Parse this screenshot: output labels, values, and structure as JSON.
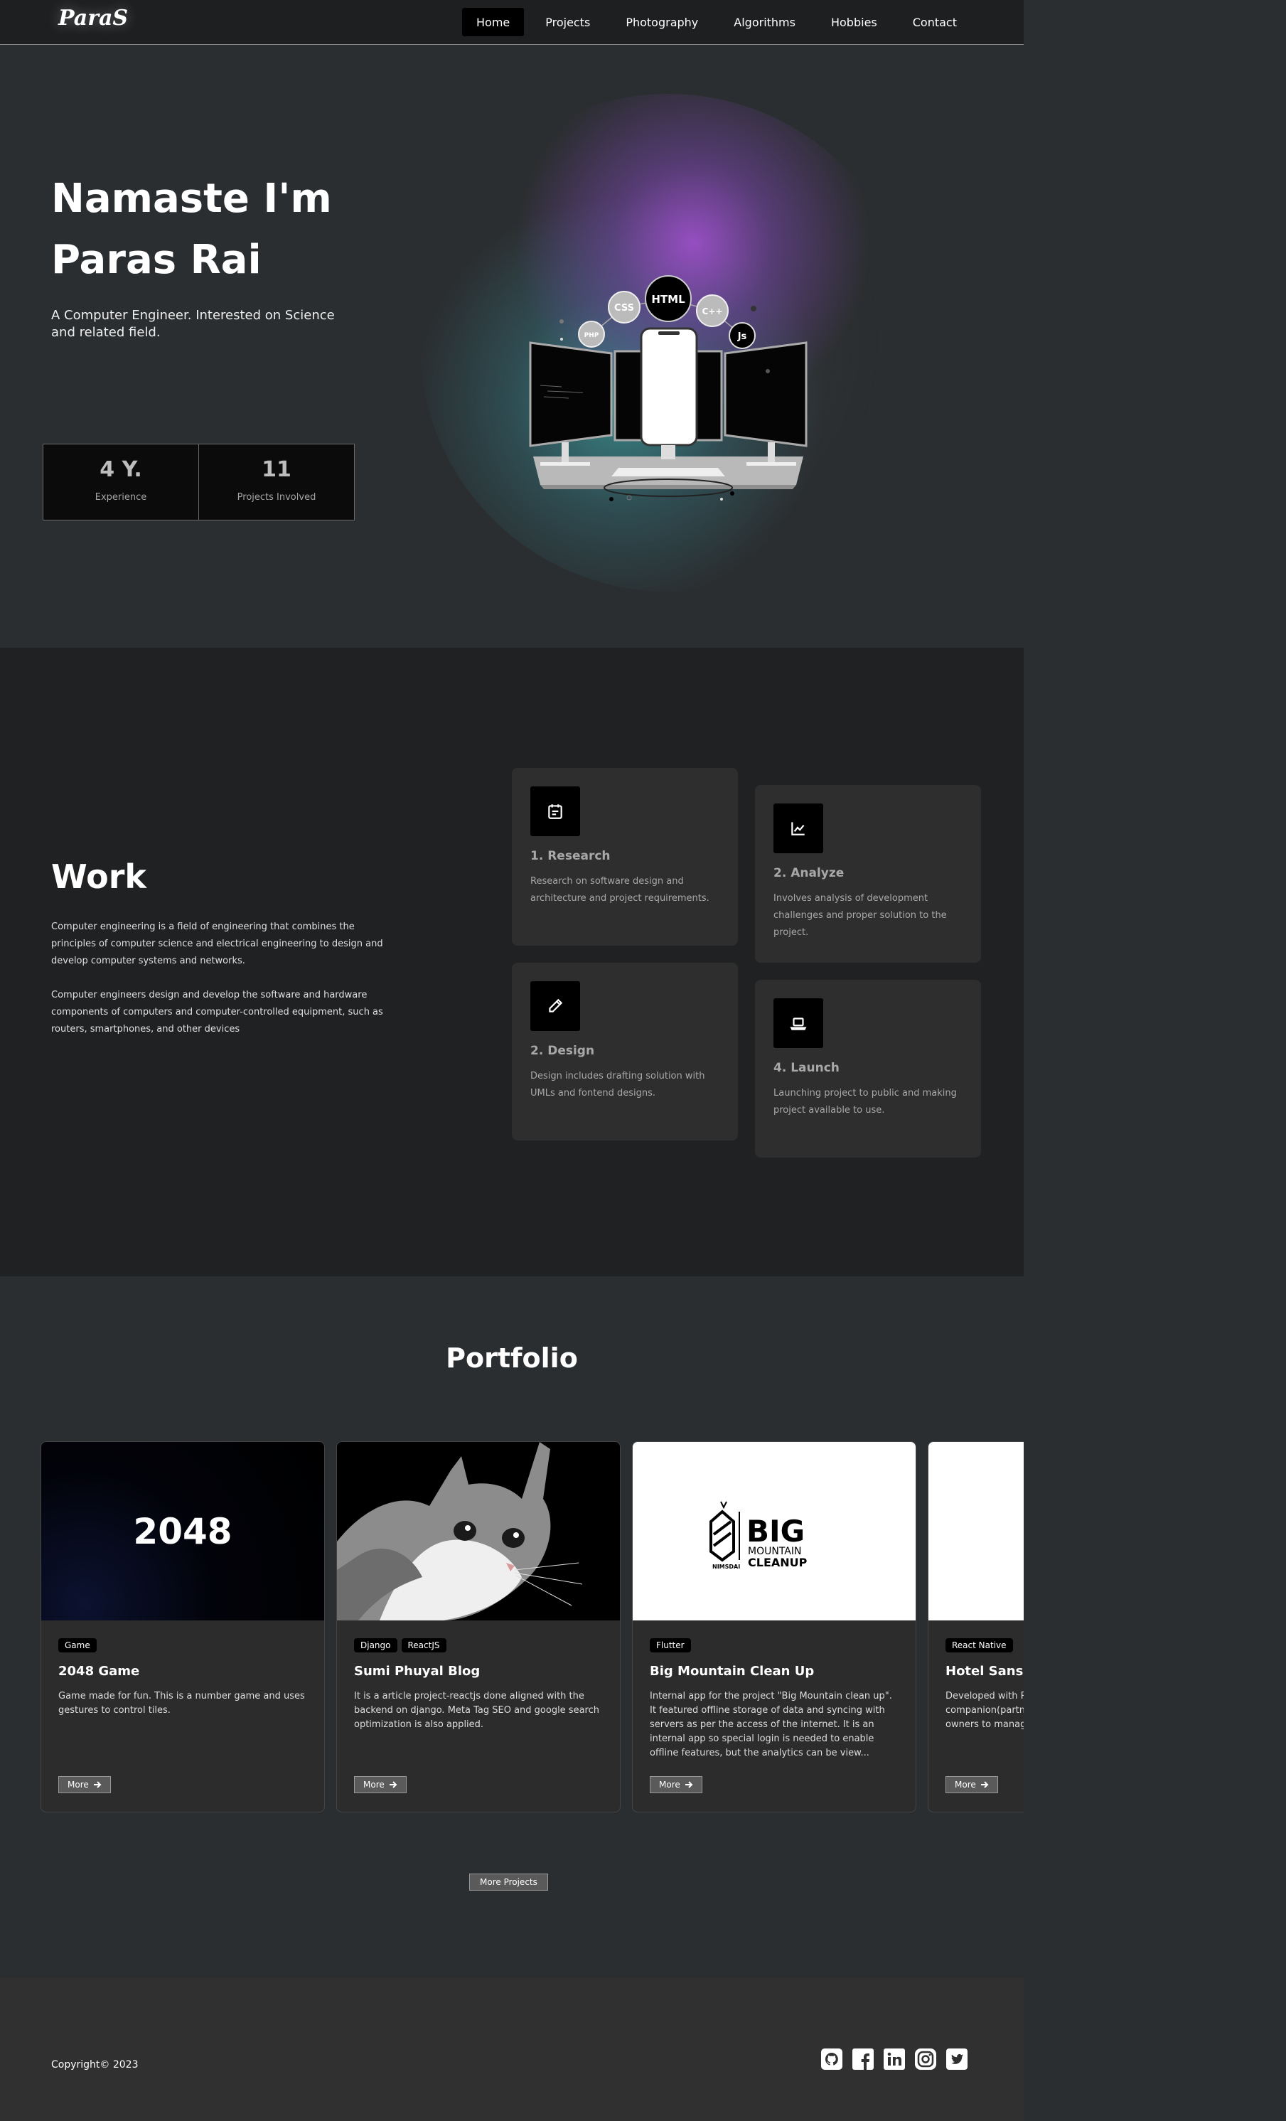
{
  "nav": {
    "logo": "ParaS",
    "links": [
      {
        "label": "Home",
        "active": true
      },
      {
        "label": "Projects"
      },
      {
        "label": "Photography"
      },
      {
        "label": "Algorithms"
      },
      {
        "label": "Hobbies"
      },
      {
        "label": "Contact"
      }
    ]
  },
  "hero": {
    "title_line1": "Namaste I'm",
    "title_line2": "Paras Rai",
    "subtitle": "A Computer Engineer. Interested on Science and related field.",
    "badges": [
      "HTML",
      "CSS",
      "C++",
      "Js",
      "PHP"
    ],
    "stats": [
      {
        "value": "4 Y.",
        "label": "Experience"
      },
      {
        "value": "11",
        "label": "Projects Involved"
      }
    ]
  },
  "work": {
    "title": "Work",
    "paragraph1": "Computer engineering is a field of engineering that combines the principles of computer science and electrical engineering to design and develop computer systems and networks.",
    "paragraph2": "Computer engineers design and develop the software and hardware components of computers and computer-controlled equipment, such as routers, smartphones, and other devices",
    "cards": [
      {
        "icon": "calendar-icon",
        "title": "1. Research",
        "text": "Research on software design and architecture and project requirements."
      },
      {
        "icon": "chart-line-icon",
        "title": "2. Analyze",
        "text": "Involves analysis of development challenges and proper solution to the project."
      },
      {
        "icon": "pencil-icon",
        "title": "2. Design",
        "text": "Design includes drafting solution with UMLs and fontend designs."
      },
      {
        "icon": "laptop-icon",
        "title": "4. Launch",
        "text": "Launching project to public and making project available to use."
      }
    ]
  },
  "portfolio": {
    "title": "Portfolio",
    "projects": [
      {
        "image_text": "2048",
        "tags": [
          "Game"
        ],
        "title": "2048 Game",
        "desc": "Game made for fun. This is a number game and uses gestures to control tiles.",
        "more": "More"
      },
      {
        "tags": [
          "Django",
          "ReactJS"
        ],
        "title": "Sumi Phuyal Blog",
        "desc": "It is a article project-reactjs done aligned with the backend on django. Meta Tag SEO and google search optimization is also applied.",
        "more": "More"
      },
      {
        "logo_big": "BIG",
        "logo_mountain": "MOUNTAIN",
        "logo_cleanup": "CLEANUP",
        "logo_brand": "NIMSDAI",
        "tags": [
          "Flutter"
        ],
        "title": "Big Mountain Clean Up",
        "desc": "Internal app for the project \"Big Mountain clean up\". It featured offline storage of data and syncing with servers as per the access of the internet. It is an internal app so special login is needed to enable offline features, but the analytics can be view...",
        "more": "More"
      },
      {
        "tags": [
          "React Native"
        ],
        "title": "Hotel Sansaar",
        "desc": "Developed with React Native as a companion(partner) app targeting hotels and hotel owners to manage hotels with GPS and maps along",
        "more": "More"
      }
    ],
    "more_projects": "More Projects"
  },
  "footer": {
    "copyright": "Copyright© 2023",
    "socials": [
      "github-icon",
      "facebook-icon",
      "linkedin-icon",
      "instagram-icon",
      "twitter-icon"
    ]
  }
}
